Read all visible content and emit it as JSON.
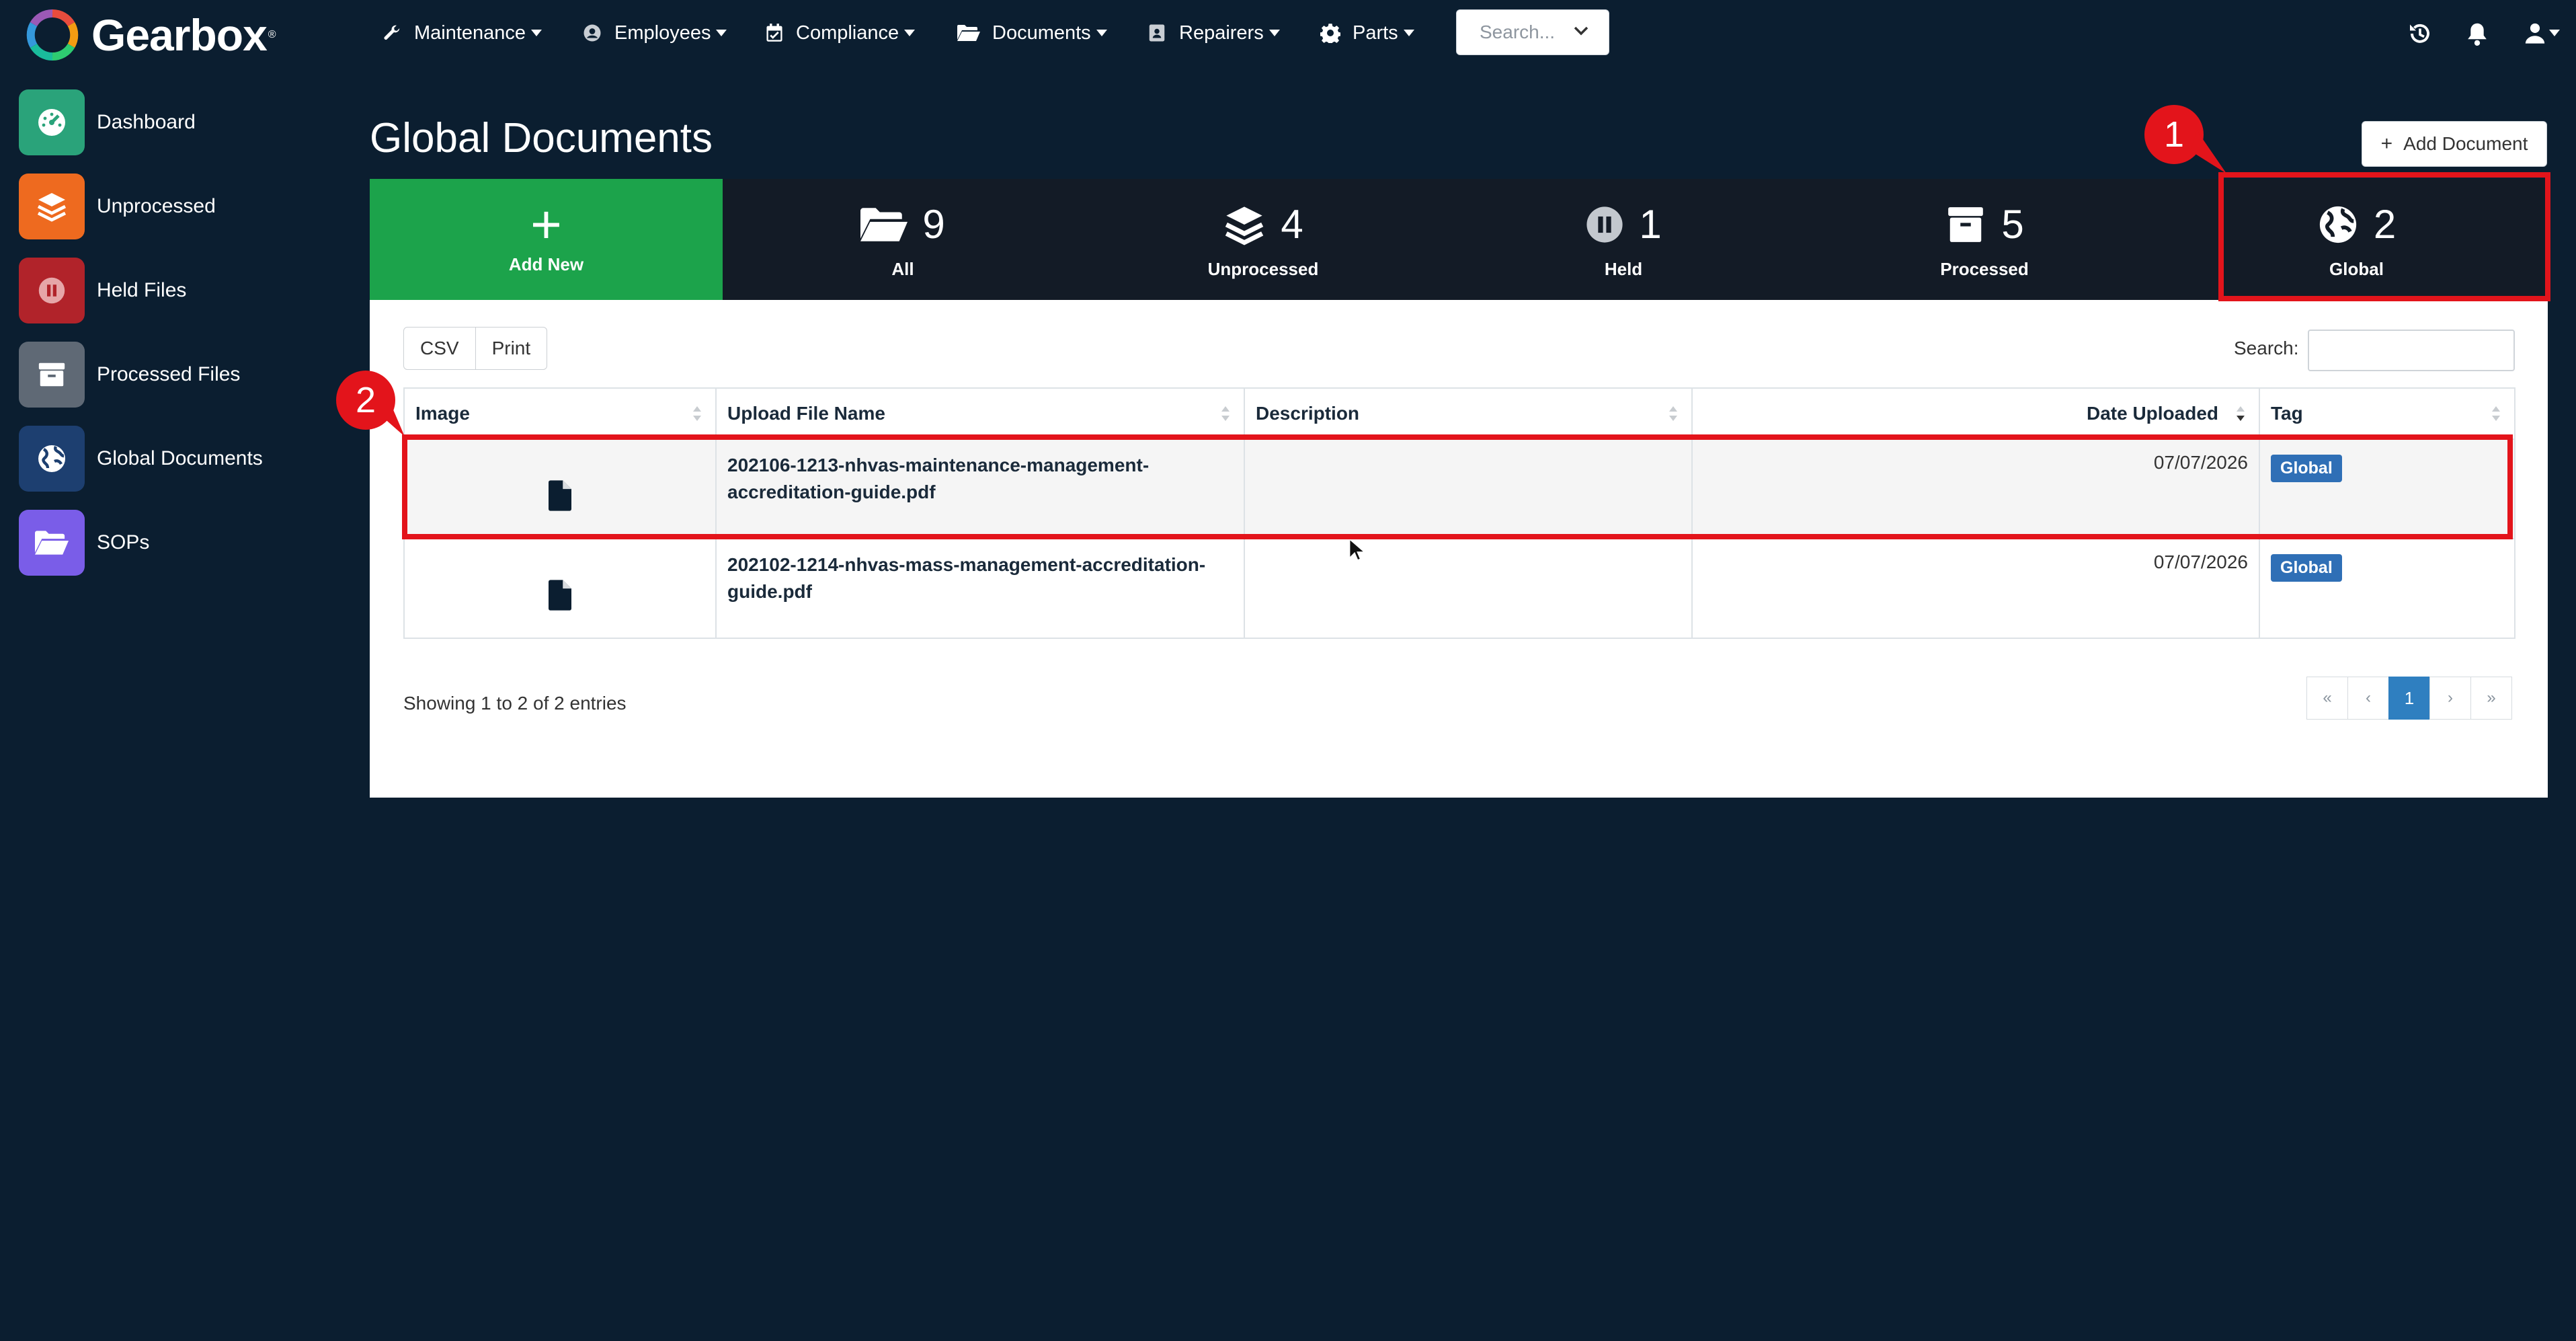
{
  "app": {
    "name": "Gearbox",
    "reg": "®"
  },
  "nav": {
    "items": [
      {
        "label": "Maintenance",
        "icon": "wrench-icon"
      },
      {
        "label": "Employees",
        "icon": "user-circle-icon"
      },
      {
        "label": "Compliance",
        "icon": "calendar-check-icon"
      },
      {
        "label": "Documents",
        "icon": "folder-open-icon"
      },
      {
        "label": "Repairers",
        "icon": "id-card-icon"
      },
      {
        "label": "Parts",
        "icon": "gear-icon"
      }
    ],
    "search_placeholder": "Search..."
  },
  "sidebar": {
    "items": [
      {
        "label": "Dashboard",
        "icon": "dashboard-gauge-icon",
        "color": "#2aa37a"
      },
      {
        "label": "Unprocessed",
        "icon": "layers-icon",
        "color": "#ee6a1f"
      },
      {
        "label": "Held Files",
        "icon": "pause-icon",
        "color": "#b1232a"
      },
      {
        "label": "Processed Files",
        "icon": "archive-box-icon",
        "color": "#5f6975"
      },
      {
        "label": "Global Documents",
        "icon": "globe-icon",
        "color": "#1d3f70"
      },
      {
        "label": "SOPs",
        "icon": "folder-open-icon",
        "color": "#7a5de8"
      }
    ]
  },
  "page": {
    "title": "Global Documents",
    "add_button": "Add Document",
    "add_button_symbol": "+"
  },
  "stats": {
    "add_new": {
      "symbol": "+",
      "label": "Add New"
    },
    "tiles": [
      {
        "count": "9",
        "label": "All",
        "icon": "folder-open-icon"
      },
      {
        "count": "4",
        "label": "Unprocessed",
        "icon": "layers-icon"
      },
      {
        "count": "1",
        "label": "Held",
        "icon": "pause-circle-icon"
      },
      {
        "count": "5",
        "label": "Processed",
        "icon": "archive-box-icon"
      },
      {
        "count": "2",
        "label": "Global",
        "icon": "globe-icon"
      }
    ]
  },
  "table": {
    "export_buttons": [
      "CSV",
      "Print"
    ],
    "search_label": "Search:",
    "columns": [
      "Image",
      "Upload File Name",
      "Description",
      "Date Uploaded",
      "Tag"
    ],
    "rows": [
      {
        "filename_line1": "202106-1213-nhvas-maintenance-management-",
        "filename_line2": "accreditation-guide.pdf",
        "description": "",
        "date": "07/07/2026",
        "tag": "Global"
      },
      {
        "filename_line1": "202102-1214-nhvas-mass-management-accreditation-",
        "filename_line2": "guide.pdf",
        "description": "",
        "date": "07/07/2026",
        "tag": "Global"
      }
    ],
    "footer": "Showing 1 to 2 of 2 entries",
    "pagination": {
      "first": "«",
      "prev": "‹",
      "current": "1",
      "next": "›",
      "last": "»"
    }
  },
  "annotations": [
    {
      "number": "1",
      "color": "#e3141b"
    },
    {
      "number": "2",
      "color": "#e3141b"
    }
  ]
}
